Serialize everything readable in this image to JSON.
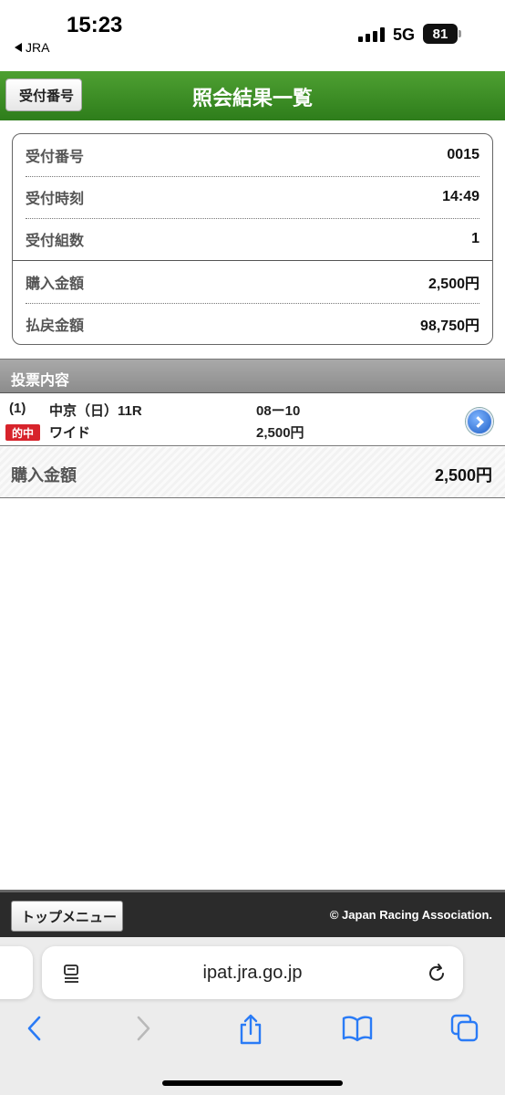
{
  "status_bar": {
    "time": "15:23",
    "back_app": "JRA",
    "network": "5G",
    "battery": "81"
  },
  "header": {
    "back_label": "受付番号",
    "title": "照会結果一覧",
    "bg_color": "#3a8a22"
  },
  "summary": {
    "rows": [
      {
        "label": "受付番号",
        "value": "0015"
      },
      {
        "label": "受付時刻",
        "value": "14:49"
      },
      {
        "label": "受付組数",
        "value": "1"
      },
      {
        "label": "購入金額",
        "value": "2,500円"
      },
      {
        "label": "払戻金額",
        "value": "98,750円"
      }
    ]
  },
  "section": {
    "title": "投票内容"
  },
  "bet": {
    "number": "(1)",
    "race": "中京（日）11R",
    "combination": "08ー10",
    "hit_badge": "的中",
    "bet_type": "ワイド",
    "amount": "2,500円",
    "detail_icon": "chevron-right-circle-icon"
  },
  "total": {
    "label": "購入金額",
    "value": "2,500円"
  },
  "footer": {
    "top_menu_label": "トップメニュー",
    "copyright": "© Japan Racing Association."
  },
  "browser": {
    "url": "ipat.jra.go.jp",
    "icons": [
      "reader-icon",
      "reload-icon",
      "back-icon",
      "forward-icon",
      "share-icon",
      "bookmarks-icon",
      "tabs-icon"
    ]
  }
}
